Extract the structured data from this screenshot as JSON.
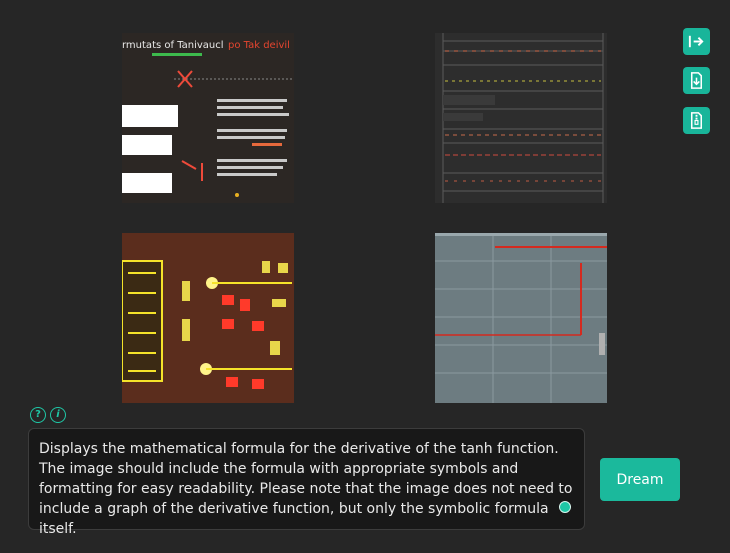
{
  "gallery": {
    "tiles": [
      {
        "id": "image-1",
        "heading": "rmutats of Tanivaucl",
        "heading_accent": "po Tak deivil"
      },
      {
        "id": "image-2"
      },
      {
        "id": "image-3"
      },
      {
        "id": "image-4"
      }
    ]
  },
  "sidebar": {
    "buttons": [
      {
        "name": "export-icon"
      },
      {
        "name": "download-icon"
      },
      {
        "name": "zip-file-icon"
      }
    ]
  },
  "help": {
    "icons": [
      {
        "name": "question-icon",
        "glyph": "?"
      },
      {
        "name": "info-icon",
        "glyph": "i"
      }
    ]
  },
  "prompt": {
    "text": "Displays the mathematical formula for the derivative of the tanh function. The image should include the formula with appropriate symbols and formatting for easy readability. Please note that the image does not need to include a graph of the derivative function, but only the symbolic formula itself."
  },
  "actions": {
    "dream_label": "Dream"
  },
  "colors": {
    "accent": "#1bb99c",
    "background": "#262626",
    "prompt_bg": "#181818"
  }
}
